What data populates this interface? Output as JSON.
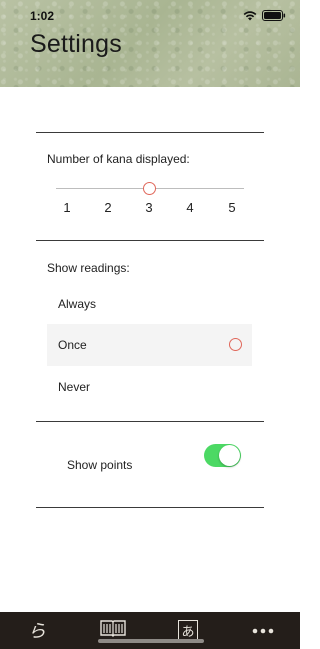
{
  "status": {
    "time": "1:02"
  },
  "header": {
    "title": "Settings"
  },
  "kana": {
    "label": "Number of kana displayed:",
    "ticks": [
      "1",
      "2",
      "3",
      "4",
      "5"
    ],
    "selected": "3"
  },
  "readings": {
    "label": "Show readings:",
    "options": [
      "Always",
      "Once",
      "Never"
    ],
    "selected": "Once"
  },
  "points": {
    "label": "Show points",
    "enabled": true
  },
  "tabbar": {
    "tabs": [
      {
        "icon": "kana-stroke-icon",
        "glyph": "ら"
      },
      {
        "icon": "book-icon"
      },
      {
        "icon": "kana-card-icon",
        "glyph": "あ"
      },
      {
        "icon": "more-icon"
      }
    ]
  },
  "colors": {
    "accent": "#e0675a",
    "toggle_on": "#4cd964",
    "tabbar_bg": "#241e1a"
  }
}
